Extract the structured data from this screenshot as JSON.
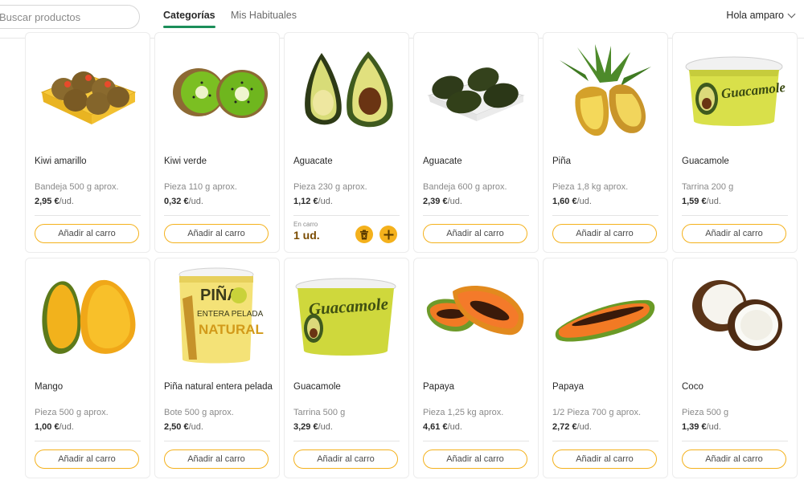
{
  "header": {
    "search_placeholder": "Buscar productos",
    "tabs": [
      "Categorías",
      "Mis Habituales"
    ],
    "user_greeting": "Hola amparo"
  },
  "products": [
    {
      "name": "Kiwi amarillo",
      "meta": "Bandeja 500 g aprox.",
      "price": "2,95 €",
      "unit": "/ud.",
      "button": "Añadir al carro"
    },
    {
      "name": "Kiwi verde",
      "meta": "Pieza 110 g aprox.",
      "price": "0,32 €",
      "unit": "/ud.",
      "button": "Añadir al carro"
    },
    {
      "name": "Aguacate",
      "meta": "Pieza 230 g aprox.",
      "price": "1,12 €",
      "unit": "/ud.",
      "in_cart_label": "En carro",
      "in_cart_qty": "1 ud."
    },
    {
      "name": "Aguacate",
      "meta": "Bandeja 600 g aprox.",
      "price": "2,39 €",
      "unit": "/ud.",
      "button": "Añadir al carro"
    },
    {
      "name": "Piña",
      "meta": "Pieza 1,8 kg aprox.",
      "price": "1,60 €",
      "unit": "/ud.",
      "button": "Añadir al carro"
    },
    {
      "name": "Guacamole",
      "meta": "Tarrina 200 g",
      "price": "1,59 €",
      "unit": "/ud.",
      "button": "Añadir al carro"
    },
    {
      "name": "Mango",
      "meta": "Pieza 500 g aprox.",
      "price": "1,00 €",
      "unit": "/ud.",
      "button": "Añadir al carro"
    },
    {
      "name": "Piña natural entera pelada",
      "meta": "Bote 500 g aprox.",
      "price": "2,50 €",
      "unit": "/ud.",
      "button": "Añadir al carro"
    },
    {
      "name": "Guacamole",
      "meta": "Tarrina 500 g",
      "price": "3,29 €",
      "unit": "/ud.",
      "button": "Añadir al carro"
    },
    {
      "name": "Papaya",
      "meta": "Pieza 1,25 kg aprox.",
      "price": "4,61 €",
      "unit": "/ud.",
      "button": "Añadir al carro"
    },
    {
      "name": "Papaya",
      "meta": "1/2 Pieza 700 g aprox.",
      "price": "2,72 €",
      "unit": "/ud.",
      "button": "Añadir al carro"
    },
    {
      "name": "Coco",
      "meta": "Pieza 500 g",
      "price": "1,39 €",
      "unit": "/ud.",
      "button": "Añadir al carro"
    }
  ],
  "images": {
    "jar_text_1": "Guacamole",
    "jar_text_2": "PIÑA",
    "jar_text_3": "ENTERA PELADA",
    "jar_text_4": "NATURAL"
  },
  "colors": {
    "accent": "#f4b11c",
    "tab_underline": "#1b8e5a"
  }
}
